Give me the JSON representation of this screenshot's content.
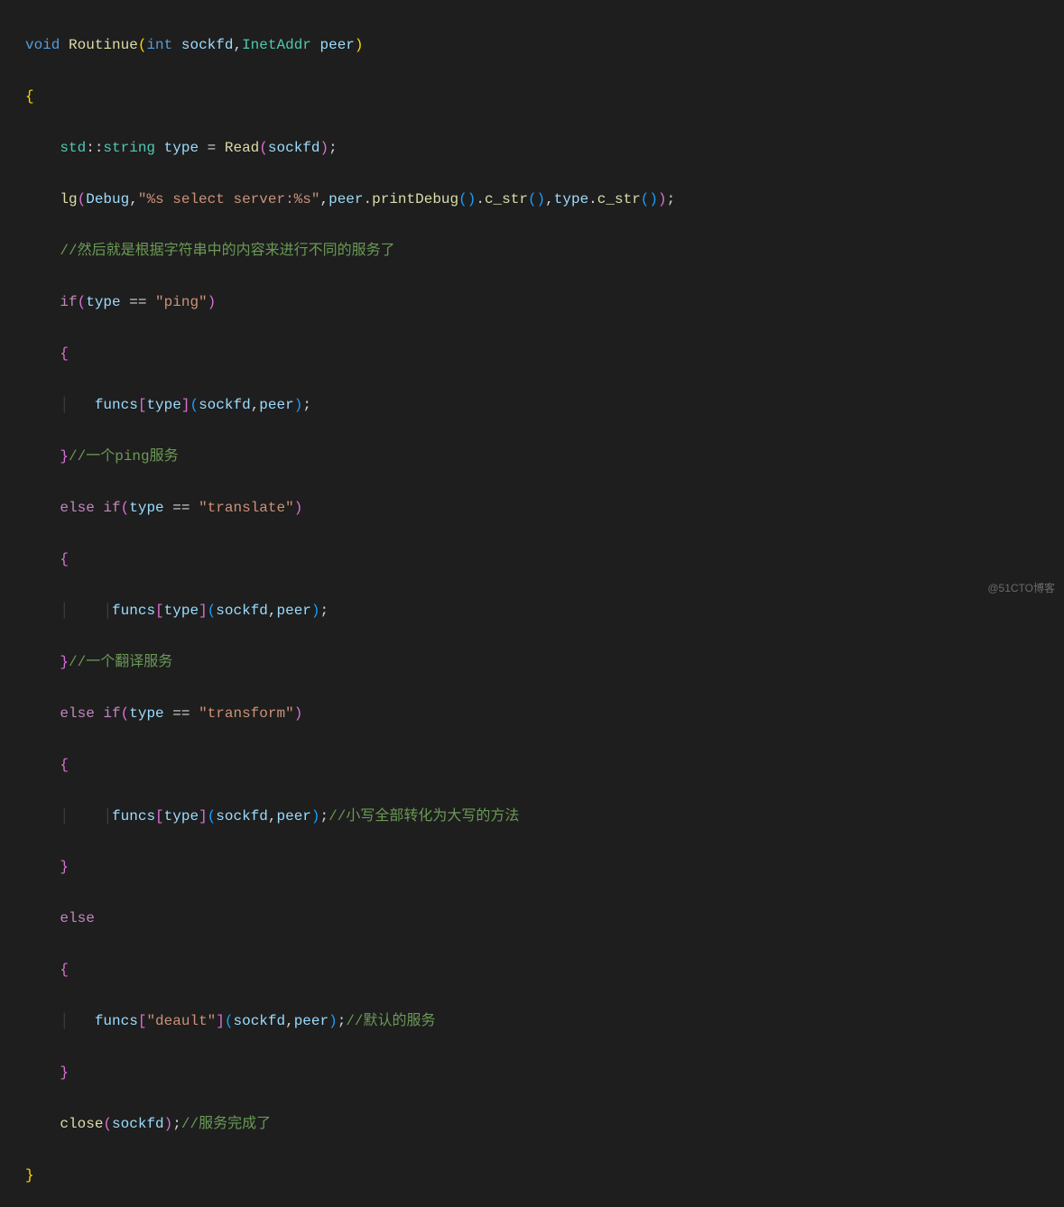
{
  "code": {
    "l1_void": "void",
    "l1_fn": "Routinue",
    "l1_int": "int",
    "l1_p1": "sockfd",
    "l1_type2": "InetAddr",
    "l1_p2": "peer",
    "l3_ns": "std",
    "l3_cls": "string",
    "l3_var": "type",
    "l3_fn": "Read",
    "l3_arg": "sockfd",
    "l4_fn": "lg",
    "l4_a1": "Debug",
    "l4_str": "\"%s select server:%s\"",
    "l4_a3": "peer",
    "l4_m1": "printDebug",
    "l4_m2": "c_str",
    "l4_a4": "type",
    "l4_m3": "c_str",
    "l5_cmt": "//然后就是根据字符串中的内容来进行不同的服务了",
    "l6_if": "if",
    "l6_var": "type",
    "l6_eq": "==",
    "l6_str": "\"ping\"",
    "l8_fn": "funcs",
    "l8_k": "type",
    "l8_a1": "sockfd",
    "l8_a2": "peer",
    "l9_cmt": "//一个ping服务",
    "l10_else": "else",
    "l10_if": "if",
    "l10_var": "type",
    "l10_eq": "==",
    "l10_str": "\"translate\"",
    "l12_fn": "funcs",
    "l12_k": "type",
    "l12_a1": "sockfd",
    "l12_a2": "peer",
    "l13_cmt": "//一个翻译服务",
    "l14_else": "else",
    "l14_if": "if",
    "l14_var": "type",
    "l14_eq": "==",
    "l14_str": "\"transform\"",
    "l16_fn": "funcs",
    "l16_k": "type",
    "l16_a1": "sockfd",
    "l16_a2": "peer",
    "l16_cmt": "//小写全部转化为大写的方法",
    "l18_else": "else",
    "l20_fn": "funcs",
    "l20_str": "\"deault\"",
    "l20_a1": "sockfd",
    "l20_a2": "peer",
    "l20_cmt": "//默认的服务",
    "l22_fn": "close",
    "l22_arg": "sockfd",
    "l22_cmt": "//服务完成了"
  },
  "watermark": "@51CTO博客"
}
